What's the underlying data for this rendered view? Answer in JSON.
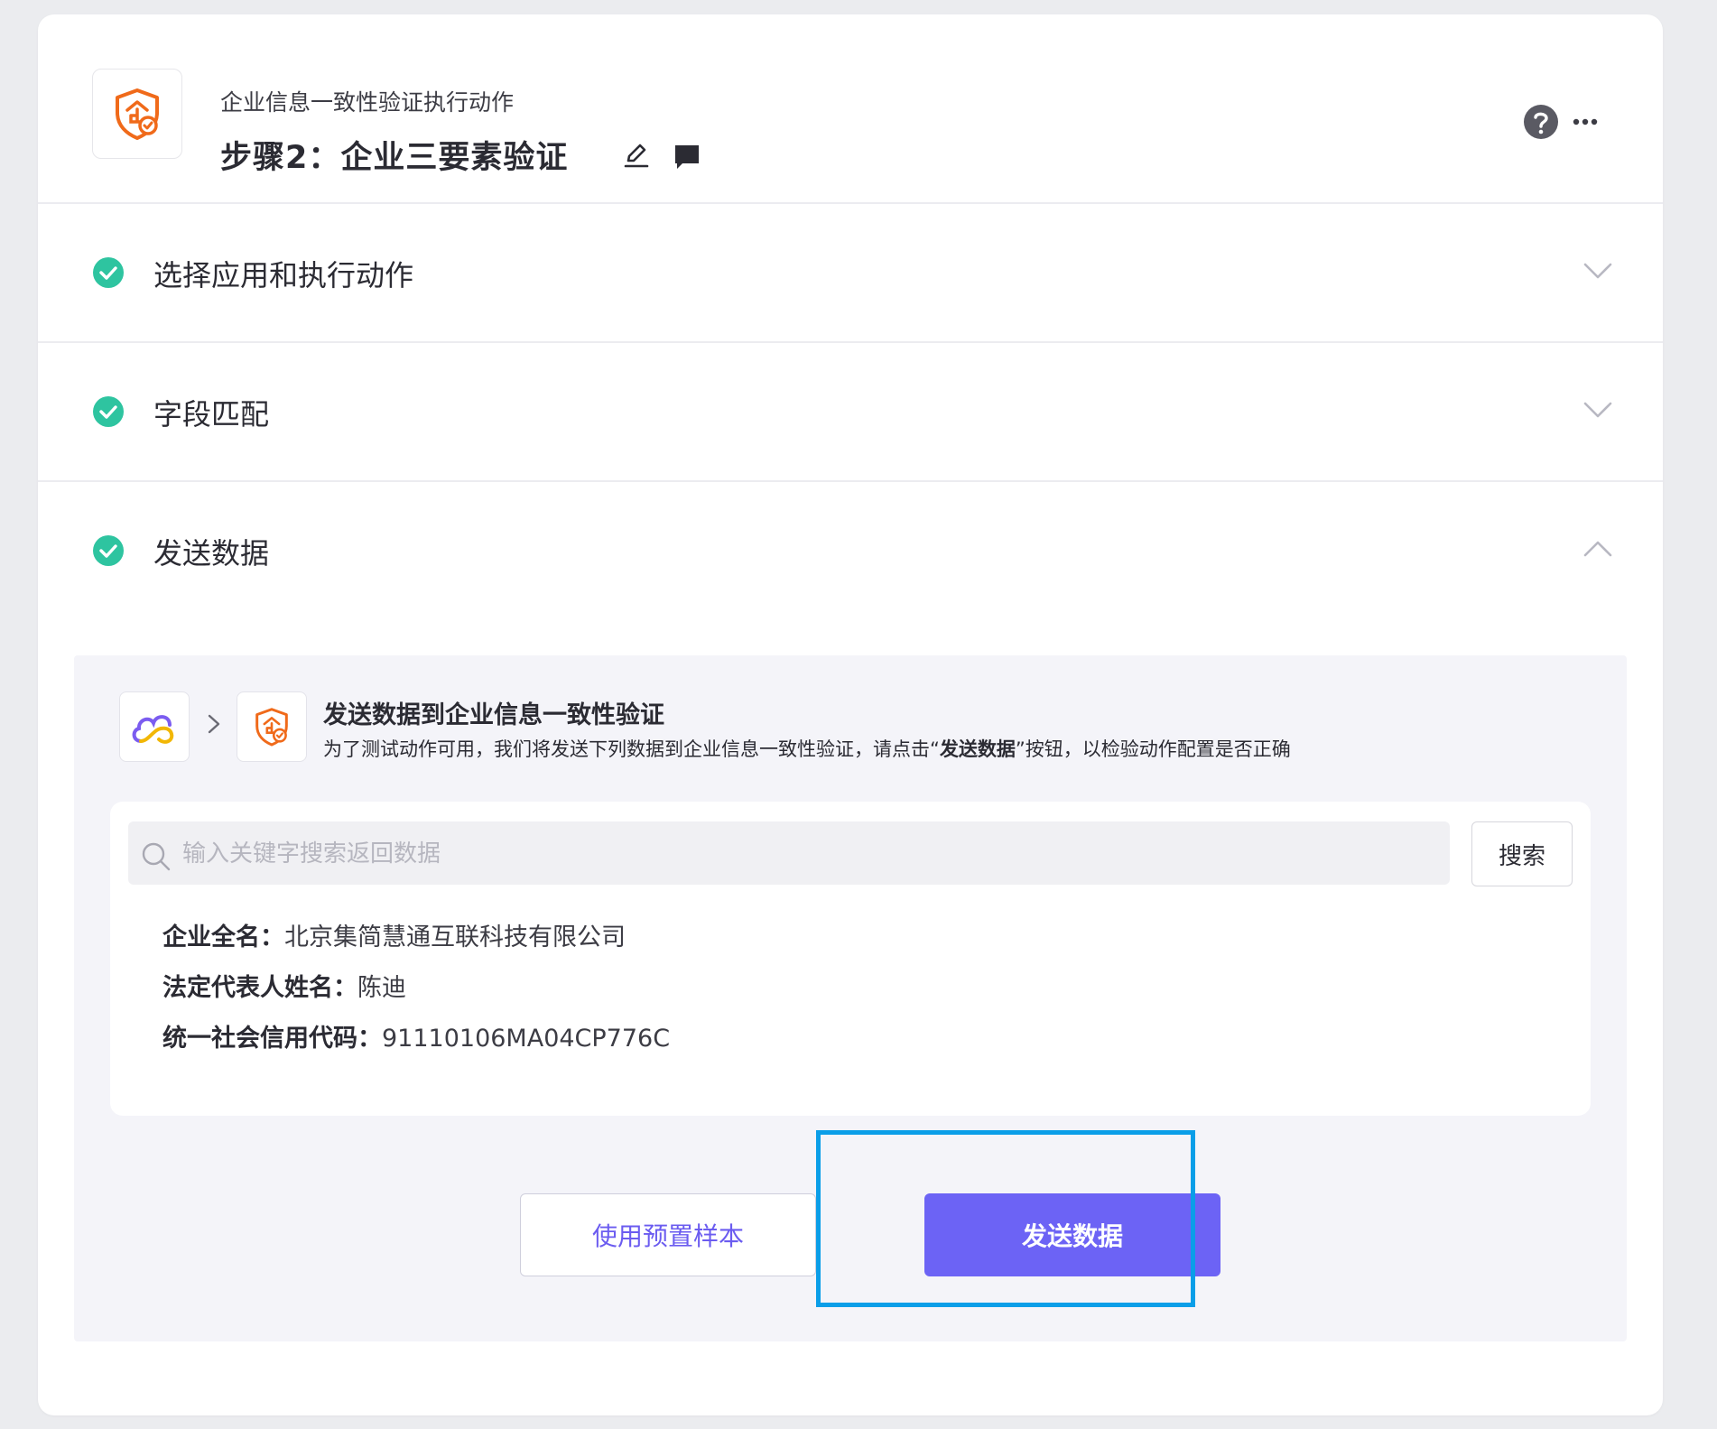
{
  "header": {
    "subtitle": "企业信息一致性验证执行动作",
    "title": "步骤2：企业三要素验证",
    "brand_color": "#f06a1a"
  },
  "sections": [
    {
      "label": "选择应用和执行动作",
      "status": "complete",
      "expanded": false
    },
    {
      "label": "字段匹配",
      "status": "complete",
      "expanded": false
    },
    {
      "label": "发送数据",
      "status": "complete",
      "expanded": true
    }
  ],
  "send_panel": {
    "title": "发送数据到企业信息一致性验证",
    "desc_before": "为了测试动作可用，我们将发送下列数据到企业信息一致性验证，请点击“",
    "desc_bold": "发送数据",
    "desc_after": "”按钮，以检验动作配置是否正确",
    "search": {
      "placeholder": "输入关键字搜索返回数据",
      "value": "",
      "button_label": "搜索"
    },
    "fields": [
      {
        "key": "企业全名：",
        "value": "北京集简慧通互联科技有限公司"
      },
      {
        "key": "法定代表人姓名：",
        "value": "陈迪"
      },
      {
        "key": "统一社会信用代码：",
        "value": "91110106MA04CP776C"
      }
    ],
    "sample_button": "使用预置样本",
    "send_button": "发送数据"
  },
  "colors": {
    "accent": "#6c63f5",
    "success": "#2ec4a0",
    "highlight": "#0a9ee8"
  }
}
